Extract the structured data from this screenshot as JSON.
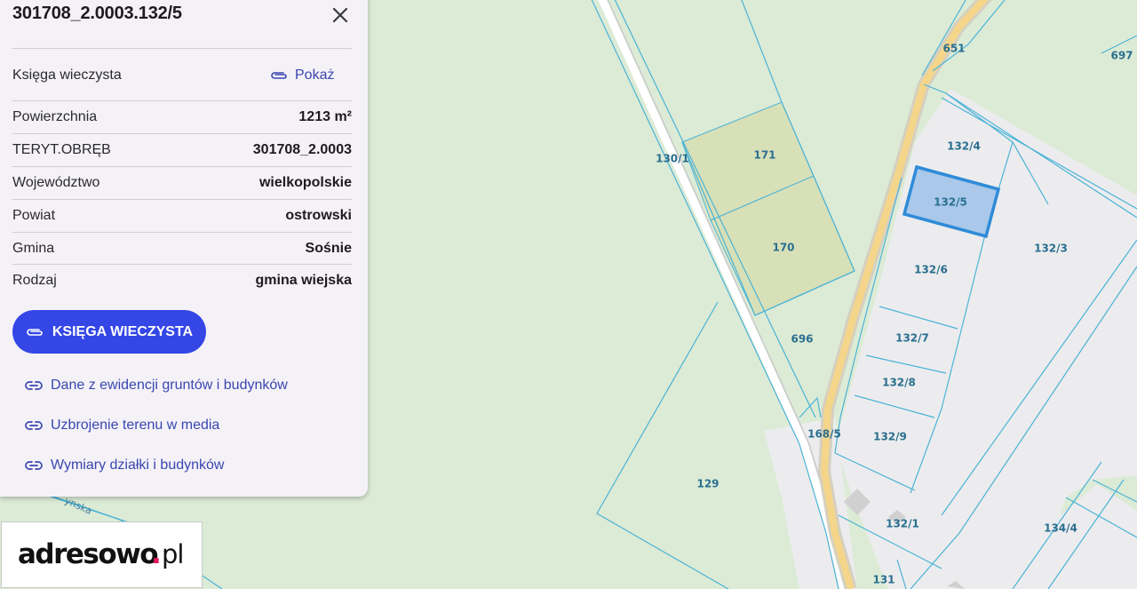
{
  "panel": {
    "title": "301708_2.0003.132/5",
    "kw_row": {
      "label": "Księga wieczysta",
      "link_label": "Pokaż"
    },
    "rows": [
      {
        "label": "Powierzchnia",
        "value": "1213 m²"
      },
      {
        "label": "TERYT.OBRĘB",
        "value": "301708_2.0003"
      },
      {
        "label": "Województwo",
        "value": "wielkopolskie"
      },
      {
        "label": "Powiat",
        "value": "ostrowski"
      },
      {
        "label": "Gmina",
        "value": "Sośnie"
      },
      {
        "label": "Rodzaj",
        "value": "gmina wiejska"
      }
    ],
    "kw_button_label": "KSIĘGA WIECZYSTA",
    "links": [
      {
        "label": "Dane z ewidencji gruntów i budynków"
      },
      {
        "label": "Uzbrojenie terenu w media"
      },
      {
        "label": "Wymiary działki i budynków"
      }
    ],
    "close_icon": "close-icon",
    "link_icon": "link-icon"
  },
  "map": {
    "parcels": {
      "p651": "651",
      "p697": "697",
      "p1301": "130/1",
      "p171": "171",
      "p170": "170",
      "p1324": "132/4",
      "p1325": "132/5",
      "p1323": "132/3",
      "p1326": "132/6",
      "p696": "696",
      "p1327": "132/7",
      "p1328": "132/8",
      "p1329": "132/9",
      "p1685": "168/5",
      "p129": "129",
      "p1321": "132/1",
      "p1344": "134/4",
      "p131": "131"
    },
    "road_label": "ynska",
    "selected_parcel": "132/5"
  },
  "logo": {
    "text_main": "adresowo",
    "text_dot": ".",
    "text_tld": "pl"
  },
  "colors": {
    "accent": "#3446e6",
    "link": "#3a46b0",
    "map_background": "#dcebd6",
    "parcel_line": "#4ab3d6",
    "selected_parcel_fill": "#a9c8ea",
    "selected_parcel_border": "#2f8bd8",
    "road_fill": "#f4d58a",
    "agricultural_fill": "#d8e0b8",
    "logo_dot": "#e8175d"
  }
}
